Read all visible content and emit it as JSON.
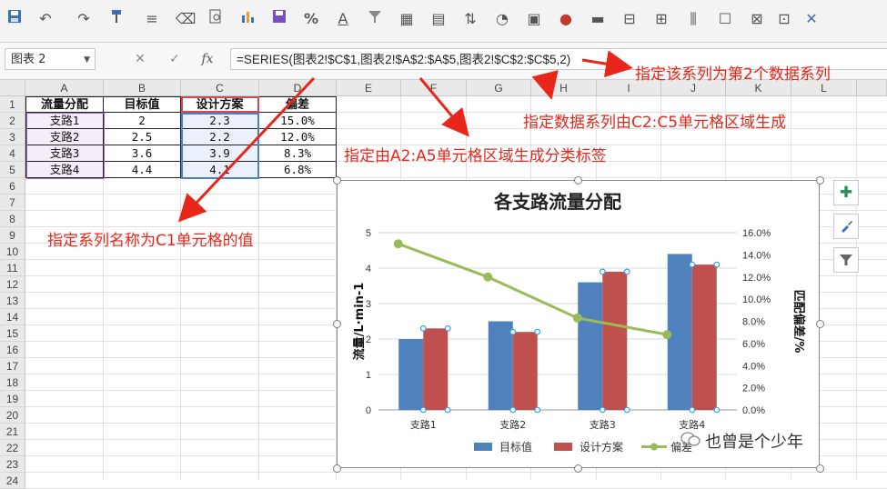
{
  "toolbar": {
    "icons": [
      "save-icon",
      "undo-icon",
      "redo-icon",
      "format-painter-icon",
      "align-icon",
      "clear-icon",
      "preview-icon",
      "chart-icon",
      "save-as-icon",
      "percent-icon",
      "font-color-icon",
      "filter-icon",
      "table-icon",
      "textbox-icon",
      "sort-icon",
      "shape-icon",
      "picture-icon",
      "insert-icon",
      "toolbox-icon",
      "merge-icon",
      "split-icon",
      "column-icon",
      "comment-icon",
      "protect-icon",
      "more-icon"
    ],
    "percent_glyph": "%",
    "font_color_glyph": "A"
  },
  "formula_bar": {
    "name_box": "图表 2",
    "cancel_glyph": "✕",
    "enter_glyph": "✓",
    "fx_label": "fx",
    "formula": "=SERIES(图表2!$C$1,图表2!$A$2:$A$5,图表2!$C$2:$C$5,2)"
  },
  "sheet": {
    "columns": [
      "A",
      "B",
      "C",
      "D",
      "E",
      "F",
      "G",
      "H",
      "I",
      "J",
      "K",
      "L"
    ],
    "rows": [
      "1",
      "2",
      "3",
      "4",
      "5",
      "6",
      "7",
      "8",
      "9",
      "10",
      "11",
      "12",
      "13",
      "14",
      "15",
      "16",
      "17",
      "18",
      "19",
      "20",
      "21",
      "22",
      "23",
      "24"
    ],
    "table": {
      "headers": [
        "流量分配",
        "目标值",
        "设计方案",
        "偏差"
      ],
      "rows": [
        [
          "支路1",
          "2",
          "2.3",
          "15.0%"
        ],
        [
          "支路2",
          "2.5",
          "2.2",
          "12.0%"
        ],
        [
          "支路3",
          "3.6",
          "3.9",
          "8.3%"
        ],
        [
          "支路4",
          "4.4",
          "4.1",
          "6.8%"
        ]
      ]
    }
  },
  "chart_data": {
    "type": "bar",
    "title": "各支路流量分配",
    "categories": [
      "支路1",
      "支路2",
      "支路3",
      "支路4"
    ],
    "ylabel": "流量/L·min-1",
    "y2label": "匹配偏差/%",
    "ylim": [
      0,
      5
    ],
    "y2lim": [
      0,
      0.16
    ],
    "yticks": [
      "0",
      "1",
      "2",
      "3",
      "4",
      "5"
    ],
    "y2ticks": [
      "0.0%",
      "2.0%",
      "4.0%",
      "6.0%",
      "8.0%",
      "10.0%",
      "12.0%",
      "14.0%",
      "16.0%"
    ],
    "legend_position": "bottom",
    "series": [
      {
        "name": "目标值",
        "type": "bar",
        "axis": "left",
        "color": "#4f81bd",
        "values": [
          2,
          2.5,
          3.6,
          4.4
        ]
      },
      {
        "name": "设计方案",
        "type": "bar",
        "axis": "left",
        "color": "#c0504d",
        "values": [
          2.3,
          2.2,
          3.9,
          4.1
        ]
      },
      {
        "name": "偏差",
        "type": "line",
        "axis": "right",
        "color": "#9bbb59",
        "values": [
          0.15,
          0.12,
          0.083,
          0.068
        ]
      }
    ]
  },
  "chart_side_buttons": [
    "add-element-icon",
    "chart-style-icon",
    "chart-filter-icon"
  ],
  "annotations": {
    "series_number": "指定该系列为第2个数据系列",
    "values_range": "指定数据系列由C2:C5单元格区域生成",
    "category_range": "指定由A2:A5单元格区域生成分类标签",
    "series_name": "指定系列名称为C1单元格的值"
  },
  "colors": {
    "arrow": "#e8261a",
    "bar1": "#4f81bd",
    "bar2": "#c0504d",
    "line": "#9bbb59"
  },
  "watermark": "也曾是个少年"
}
